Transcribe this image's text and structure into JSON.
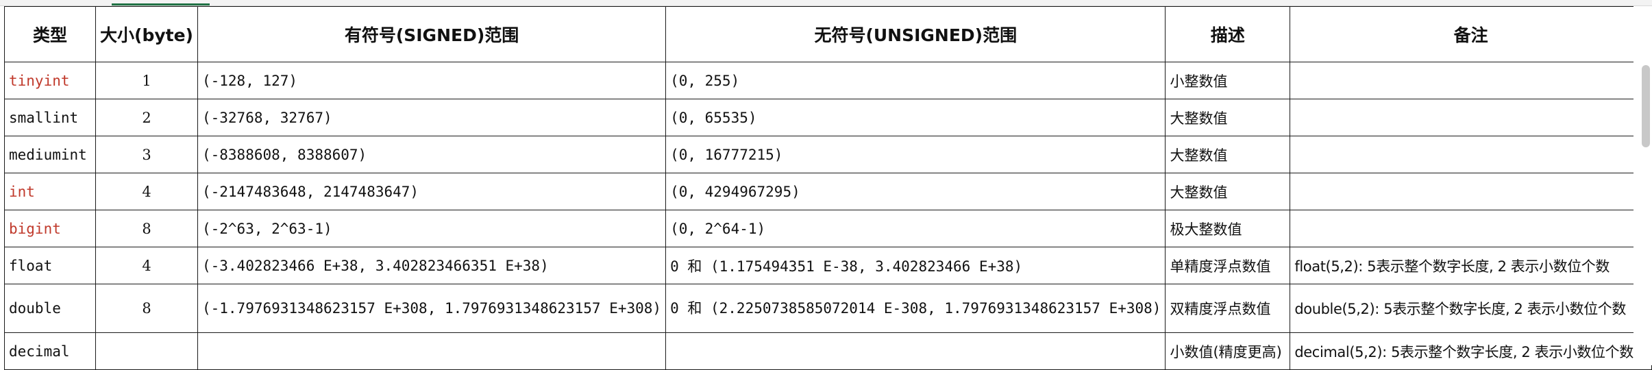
{
  "headers": {
    "type": "类型",
    "size": "大小(byte)",
    "signed": "有符号(SIGNED)范围",
    "unsigned": "无符号(UNSIGNED)范围",
    "desc": "描述",
    "note": "备注"
  },
  "rows": [
    {
      "type": "tinyint",
      "size": "1",
      "signed": "(-128, 127)",
      "unsigned": "(0, 255)",
      "desc": "小整数值",
      "note": ""
    },
    {
      "type": "smallint",
      "size": "2",
      "signed": "(-32768, 32767)",
      "unsigned": "(0, 65535)",
      "desc": "大整数值",
      "note": ""
    },
    {
      "type": "mediumint",
      "size": "3",
      "signed": "(-8388608, 8388607)",
      "unsigned": "(0, 16777215)",
      "desc": "大整数值",
      "note": ""
    },
    {
      "type": "int",
      "size": "4",
      "signed": "(-2147483648, 2147483647)",
      "unsigned": "(0, 4294967295)",
      "desc": "大整数值",
      "note": ""
    },
    {
      "type": "bigint",
      "size": "8",
      "signed": "(-2^63, 2^63-1)",
      "unsigned": "(0, 2^64-1)",
      "desc": "极大整数值",
      "note": ""
    },
    {
      "type": "float",
      "size": "4",
      "signed": "(-3.402823466 E+38, 3.402823466351 E+38)",
      "unsigned": "0 和 (1.175494351 E-38, 3.402823466 E+38)",
      "desc": "单精度浮点数值",
      "note": "float(5,2): 5表示整个数字长度, 2 表示小数位个数"
    },
    {
      "type": "double",
      "size": "8",
      "signed": "(-1.7976931348623157 E+308, 1.7976931348623157 E+308)",
      "unsigned": "0 和 (2.2250738585072014 E-308, 1.7976931348623157 E+308)",
      "desc": "双精度浮点数值",
      "note": "double(5,2): 5表示整个数字长度, 2 表示小数位个数"
    },
    {
      "type": "decimal",
      "size": "",
      "signed": "",
      "unsigned": "",
      "desc": "小数值(精度更高)",
      "note": "decimal(5,2): 5表示整个数字长度, 2 表示小数位个数"
    }
  ],
  "highlight_color": "#c0392b"
}
